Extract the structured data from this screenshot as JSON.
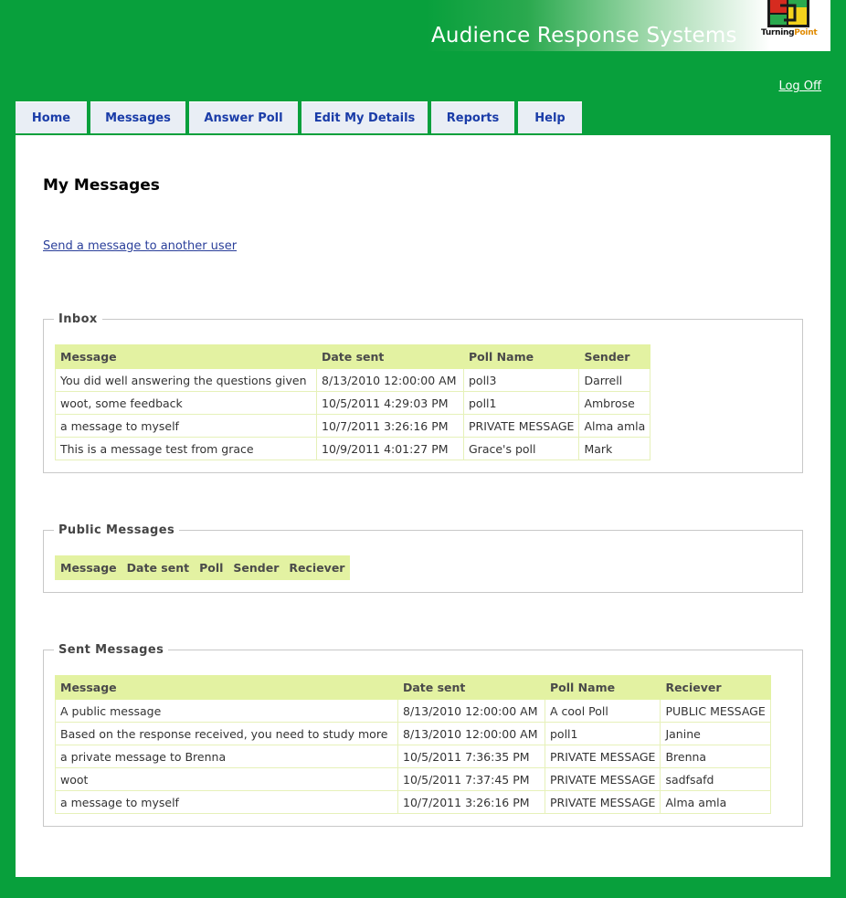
{
  "header": {
    "title": "Audience Response Systems",
    "logo_text_main": "Turning",
    "logo_text_accent": "Point",
    "logoff": "Log Off"
  },
  "nav": {
    "tabs": [
      {
        "label": "Home"
      },
      {
        "label": "Messages"
      },
      {
        "label": "Answer Poll"
      },
      {
        "label": "Edit My Details"
      },
      {
        "label": "Reports"
      },
      {
        "label": "Help"
      }
    ]
  },
  "page": {
    "title": "My Messages",
    "send_link": "Send a message to another user"
  },
  "inbox": {
    "legend": "Inbox",
    "columns": [
      "Message",
      "Date sent",
      "Poll Name",
      "Sender"
    ],
    "rows": [
      [
        "You did well answering the questions given",
        "8/13/2010 12:00:00 AM",
        "poll3",
        "Darrell"
      ],
      [
        "woot, some feedback",
        "10/5/2011 4:29:03 PM",
        "poll1",
        "Ambrose"
      ],
      [
        "a message to myself",
        "10/7/2011 3:26:16 PM",
        "PRIVATE MESSAGE",
        "Alma amla"
      ],
      [
        "This is a message test from grace",
        "10/9/2011 4:01:27 PM",
        "Grace's poll",
        "Mark"
      ]
    ]
  },
  "public": {
    "legend": "Public Messages",
    "columns": [
      "Message",
      "Date sent",
      "Poll",
      "Sender",
      "Reciever"
    ]
  },
  "sent": {
    "legend": "Sent Messages",
    "columns": [
      "Message",
      "Date sent",
      "Poll Name",
      "Reciever"
    ],
    "rows": [
      [
        "A public message",
        "8/13/2010 12:00:00 AM",
        "A cool Poll",
        "PUBLIC MESSAGE"
      ],
      [
        "Based on the response received, you need to study more",
        "8/13/2010 12:00:00 AM",
        "poll1",
        "Janine"
      ],
      [
        "a private message to Brenna",
        "10/5/2011 7:36:35 PM",
        "PRIVATE MESSAGE",
        "Brenna"
      ],
      [
        "woot",
        "10/5/2011 7:37:45 PM",
        "PRIVATE MESSAGE",
        "sadfsafd"
      ],
      [
        "a message to myself",
        "10/7/2011 3:26:16 PM",
        "PRIVATE MESSAGE",
        "Alma amla"
      ]
    ]
  },
  "colors": {
    "brand_green": "#08a03c",
    "header_row": "#e3f2a2",
    "tab_text": "#1a3ca8"
  }
}
